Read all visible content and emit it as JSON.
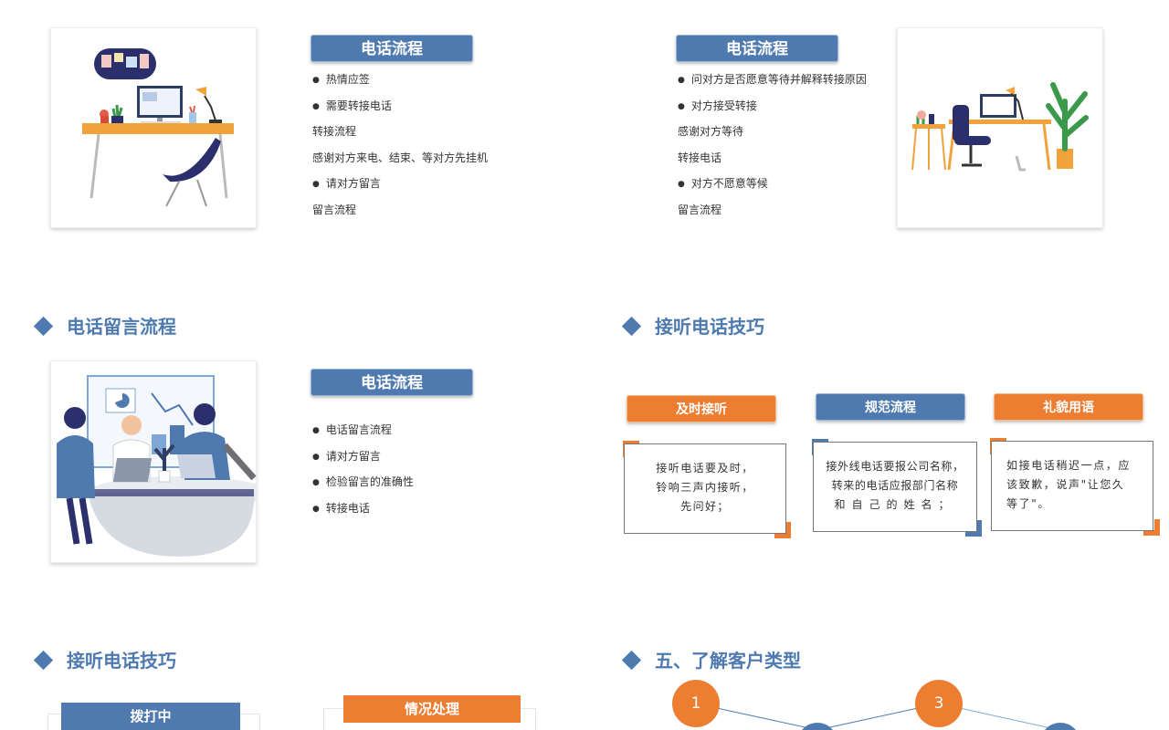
{
  "panel1": {
    "label": "电话流程",
    "items": [
      {
        "text": "热情应签",
        "bullet": true
      },
      {
        "text": "需要转接电话",
        "bullet": true
      },
      {
        "text": "转接流程",
        "bullet": false
      },
      {
        "text": "感谢对方来电、结束、等对方先挂机",
        "bullet": false
      },
      {
        "text": "请对方留言",
        "bullet": true
      },
      {
        "text": "留言流程",
        "bullet": false
      }
    ]
  },
  "panel2": {
    "label": "电话流程",
    "items": [
      {
        "text": "问对方是否愿意等待并解释转接原因",
        "bullet": true
      },
      {
        "text": "对方接受转接",
        "bullet": true
      },
      {
        "text": "感谢对方等待",
        "bullet": false
      },
      {
        "text": "转接电话",
        "bullet": false
      },
      {
        "text": "对方不愿意等候",
        "bullet": true
      },
      {
        "text": "留言流程",
        "bullet": false
      }
    ]
  },
  "section3": {
    "heading": "电话留言流程",
    "label": "电话流程",
    "items": [
      {
        "text": "电话留言流程",
        "bullet": true
      },
      {
        "text": "请对方留言",
        "bullet": true
      },
      {
        "text": "检验留言的准确性",
        "bullet": true
      },
      {
        "text": "转接电话",
        "bullet": true
      }
    ]
  },
  "section4": {
    "heading": "接听电话技巧",
    "cards": [
      {
        "label": "及时接听",
        "lines": [
          "接听电话要及时，",
          "铃响三声内接听，",
          "先问好；"
        ]
      },
      {
        "label": "规范流程",
        "lines": [
          "接外线电话要报公司名称，",
          "转来的电话应报部门名称",
          "和自己的姓名；"
        ]
      },
      {
        "label": "礼貌用语",
        "lines": [
          "如接电话稍迟一点，应",
          "该致歉，说声\"让您久",
          "等了\"。"
        ]
      }
    ]
  },
  "section5": {
    "heading": "接听电话技巧",
    "label_left": "拨打中",
    "label_right": "情况处理"
  },
  "section6": {
    "heading": "五、了解客户类型",
    "nodes": [
      "1",
      "3"
    ]
  },
  "colors": {
    "blue": "#4e7ab0",
    "orange": "#ec7d31"
  }
}
